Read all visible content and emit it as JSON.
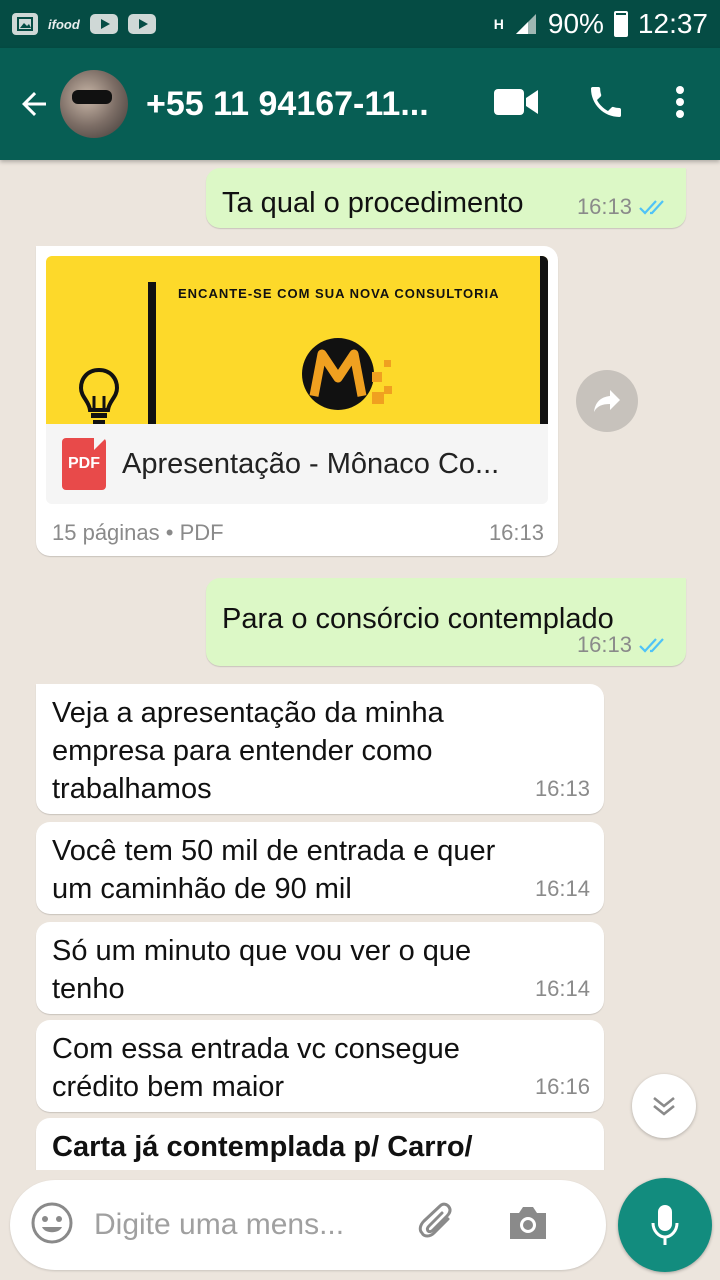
{
  "statusbar": {
    "battery": "90%",
    "time": "12:37",
    "ifood": "ifood",
    "network": "H"
  },
  "header": {
    "contact_name": "+55 11 94167-11..."
  },
  "messages": [
    {
      "dir": "out",
      "text": "Ta qual o procedimento",
      "time": "16:13"
    },
    {
      "dir": "in",
      "type": "pdf",
      "banner_text": "ENCANTE-SE COM SUA NOVA CONSULTORIA",
      "badge": "PDF",
      "file_name": "Apresentação - Mônaco Co...",
      "meta": "15 páginas • PDF",
      "time": "16:13"
    },
    {
      "dir": "out",
      "text": "Para o consórcio  contemplado",
      "time": "16:13"
    },
    {
      "dir": "in",
      "text": "Veja a apresentação da minha empresa para entender como trabalhamos",
      "time": "16:13"
    },
    {
      "dir": "in",
      "text": "Você tem 50 mil de entrada e quer um caminhão de 90 mil",
      "time": "16:14"
    },
    {
      "dir": "in",
      "text": "Só um minuto que vou ver o que tenho",
      "time": "16:14"
    },
    {
      "dir": "in",
      "text": "Com essa entrada vc consegue crédito bem maior",
      "time": "16:16"
    },
    {
      "dir": "in",
      "text": "Carta já contemplada p/ Carro/",
      "time": ""
    }
  ],
  "input": {
    "placeholder": "Digite uma mens..."
  },
  "colors": {
    "header": "#075e54",
    "statusbar": "#054c44",
    "outgoing": "#dcf8c6",
    "incoming": "#ffffff",
    "accent": "#128c7e",
    "read_ticks": "#4fc3f7"
  }
}
